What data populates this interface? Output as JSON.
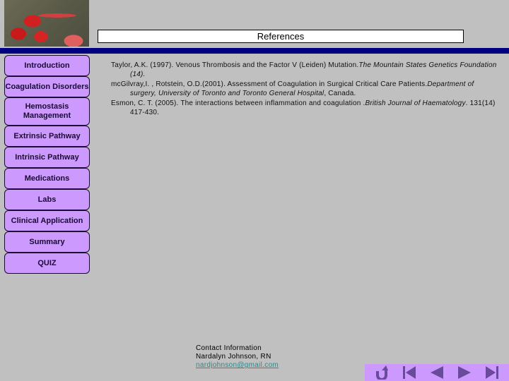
{
  "header": {
    "image_alt": "red blood cells image",
    "title": "References"
  },
  "nav": {
    "items": [
      {
        "label": "Introduction"
      },
      {
        "label": "Coagulation Disorders"
      },
      {
        "label": "Hemostasis Management"
      },
      {
        "label": "Extrinsic Pathway"
      },
      {
        "label": "Intrinsic Pathway"
      },
      {
        "label": "Medications"
      },
      {
        "label": "Labs"
      },
      {
        "label": "Clinical Application"
      },
      {
        "label": "Summary"
      },
      {
        "label": "QUIZ"
      }
    ]
  },
  "references": [
    {
      "text": "Taylor, A.K. (1997). Venous Thrombosis and the Factor V (Leiden) Mutation.",
      "italic": "The Mountain States Genetics Foundation (14).",
      "tail": ""
    },
    {
      "text": "mcGilvray,I. , Rotstein, O.D.(2001). Assessment of Coagulation in Surgical Critical Care Patients.",
      "italic": "Department of surgery, University of Toronto and Toronto General Hospital",
      "tail": ", Canada."
    },
    {
      "text": "Esmon, C. T. (2005). The interactions between inflammation and coagulation .",
      "italic": "British Journal of Haematology",
      "tail": ". 131(14) 417-430."
    }
  ],
  "contact": {
    "heading": "Contact Information",
    "name": "Nardalyn Johnson, RN",
    "email": "nardjohnson@gmail.com"
  },
  "toolbar": {
    "buttons": [
      {
        "icon": "return-icon",
        "label": "Return"
      },
      {
        "icon": "first-slide-icon",
        "label": "First"
      },
      {
        "icon": "previous-icon",
        "label": "Previous"
      },
      {
        "icon": "next-icon",
        "label": "Next"
      },
      {
        "icon": "last-slide-icon",
        "label": "Last"
      }
    ]
  },
  "colors": {
    "background": "#c0c0c0",
    "accent_bar": "#000080",
    "nav_button": "#cc99ff",
    "toolbar_icon": "#6a4a9a",
    "link": "#2a8a8a"
  }
}
